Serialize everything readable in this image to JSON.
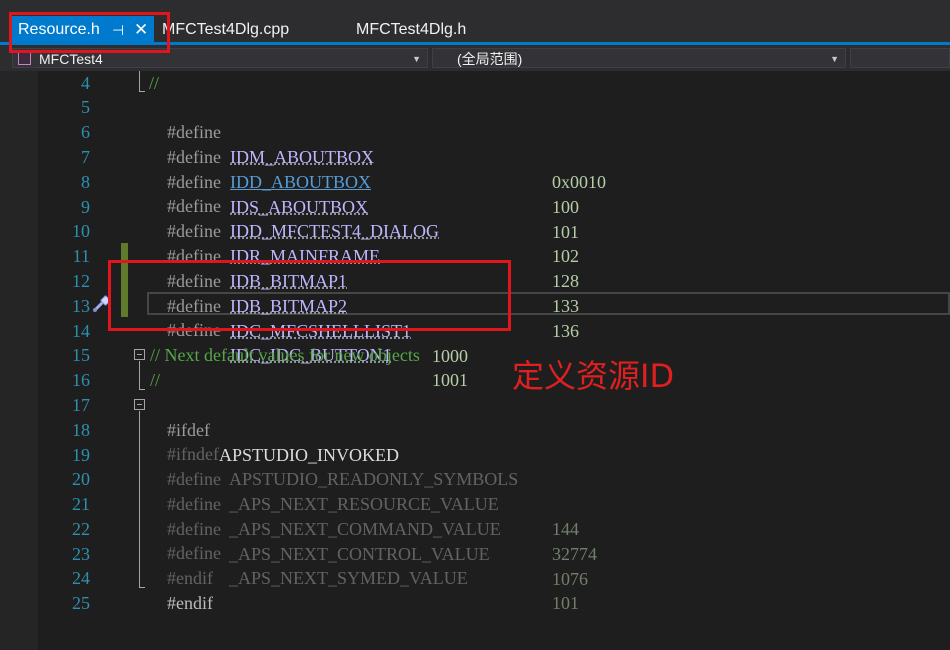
{
  "tabs": [
    {
      "label": "Resource.h",
      "active": true,
      "pin_glyph": "⊣",
      "close_glyph": "✕"
    },
    {
      "label": "MFCTest4Dlg.cpp",
      "active": false
    },
    {
      "label": "MFCTest4Dlg.h",
      "active": false
    }
  ],
  "navbar": {
    "project": "MFCTest4",
    "scope": "(全局范围)",
    "member": ""
  },
  "line_numbers": [
    "4",
    "5",
    "6",
    "7",
    "8",
    "9",
    "10",
    "11",
    "12",
    "13",
    "14",
    "15",
    "16",
    "17",
    "18",
    "19",
    "20",
    "21",
    "22",
    "23",
    "24",
    "25"
  ],
  "code": {
    "l4": {
      "comment": "//"
    },
    "l5": {
      "kw": "#define",
      "ident": "IDM_ABOUTBOX",
      "value": "0x0010"
    },
    "l6": {
      "kw": "#define",
      "ident": "IDD_ABOUTBOX",
      "value": "100"
    },
    "l7": {
      "kw": "#define",
      "ident": "IDS_ABOUTBOX",
      "value": "101"
    },
    "l8": {
      "kw": "#define",
      "ident": "IDD_MFCTEST4_DIALOG",
      "value": "102"
    },
    "l9": {
      "kw": "#define",
      "ident": "IDR_MAINFRAME",
      "value": "128"
    },
    "l10": {
      "kw": "#define",
      "ident": "IDB_BITMAP1",
      "value": "133"
    },
    "l11": {
      "kw": "#define",
      "ident": "IDB_BITMAP2",
      "value": "136"
    },
    "l12": {
      "kw": "#define",
      "ident": "IDC_MFCSHELLLIST1",
      "value": "1000"
    },
    "l13": {
      "kw": "#define",
      "ident": "IDC_IDC_BUTTON1",
      "value": "1001"
    },
    "l15": {
      "comment": "// Next default values for new objects"
    },
    "l16": {
      "comment": "//"
    },
    "l17": {
      "kw": "#ifdef",
      "ident": "APSTUDIO_INVOKED"
    },
    "l18": {
      "kw": "#ifndef",
      "ident": "APSTUDIO_READONLY_SYMBOLS"
    },
    "l19": {
      "kw": "#define",
      "ident": "_APS_NEXT_RESOURCE_VALUE",
      "value": "144"
    },
    "l20": {
      "kw": "#define",
      "ident": "_APS_NEXT_COMMAND_VALUE",
      "value": "32774"
    },
    "l21": {
      "kw": "#define",
      "ident": "_APS_NEXT_CONTROL_VALUE",
      "value": "1076"
    },
    "l22": {
      "kw": "#define",
      "ident": "_APS_NEXT_SYMED_VALUE",
      "value": "101"
    },
    "l23": {
      "kw": "#endif"
    },
    "l24": {
      "kw": "#endif"
    }
  },
  "annotation": {
    "text": "定义资源ID",
    "color": "#e0161c"
  },
  "colors": {
    "accent": "#007acc",
    "editor_bg": "#1e1e1e",
    "line_number": "#2b91af",
    "preprocessor": "#9b9b9b",
    "identifier": "#beb7ff",
    "number": "#b5cea8",
    "comment": "#57a64a"
  }
}
